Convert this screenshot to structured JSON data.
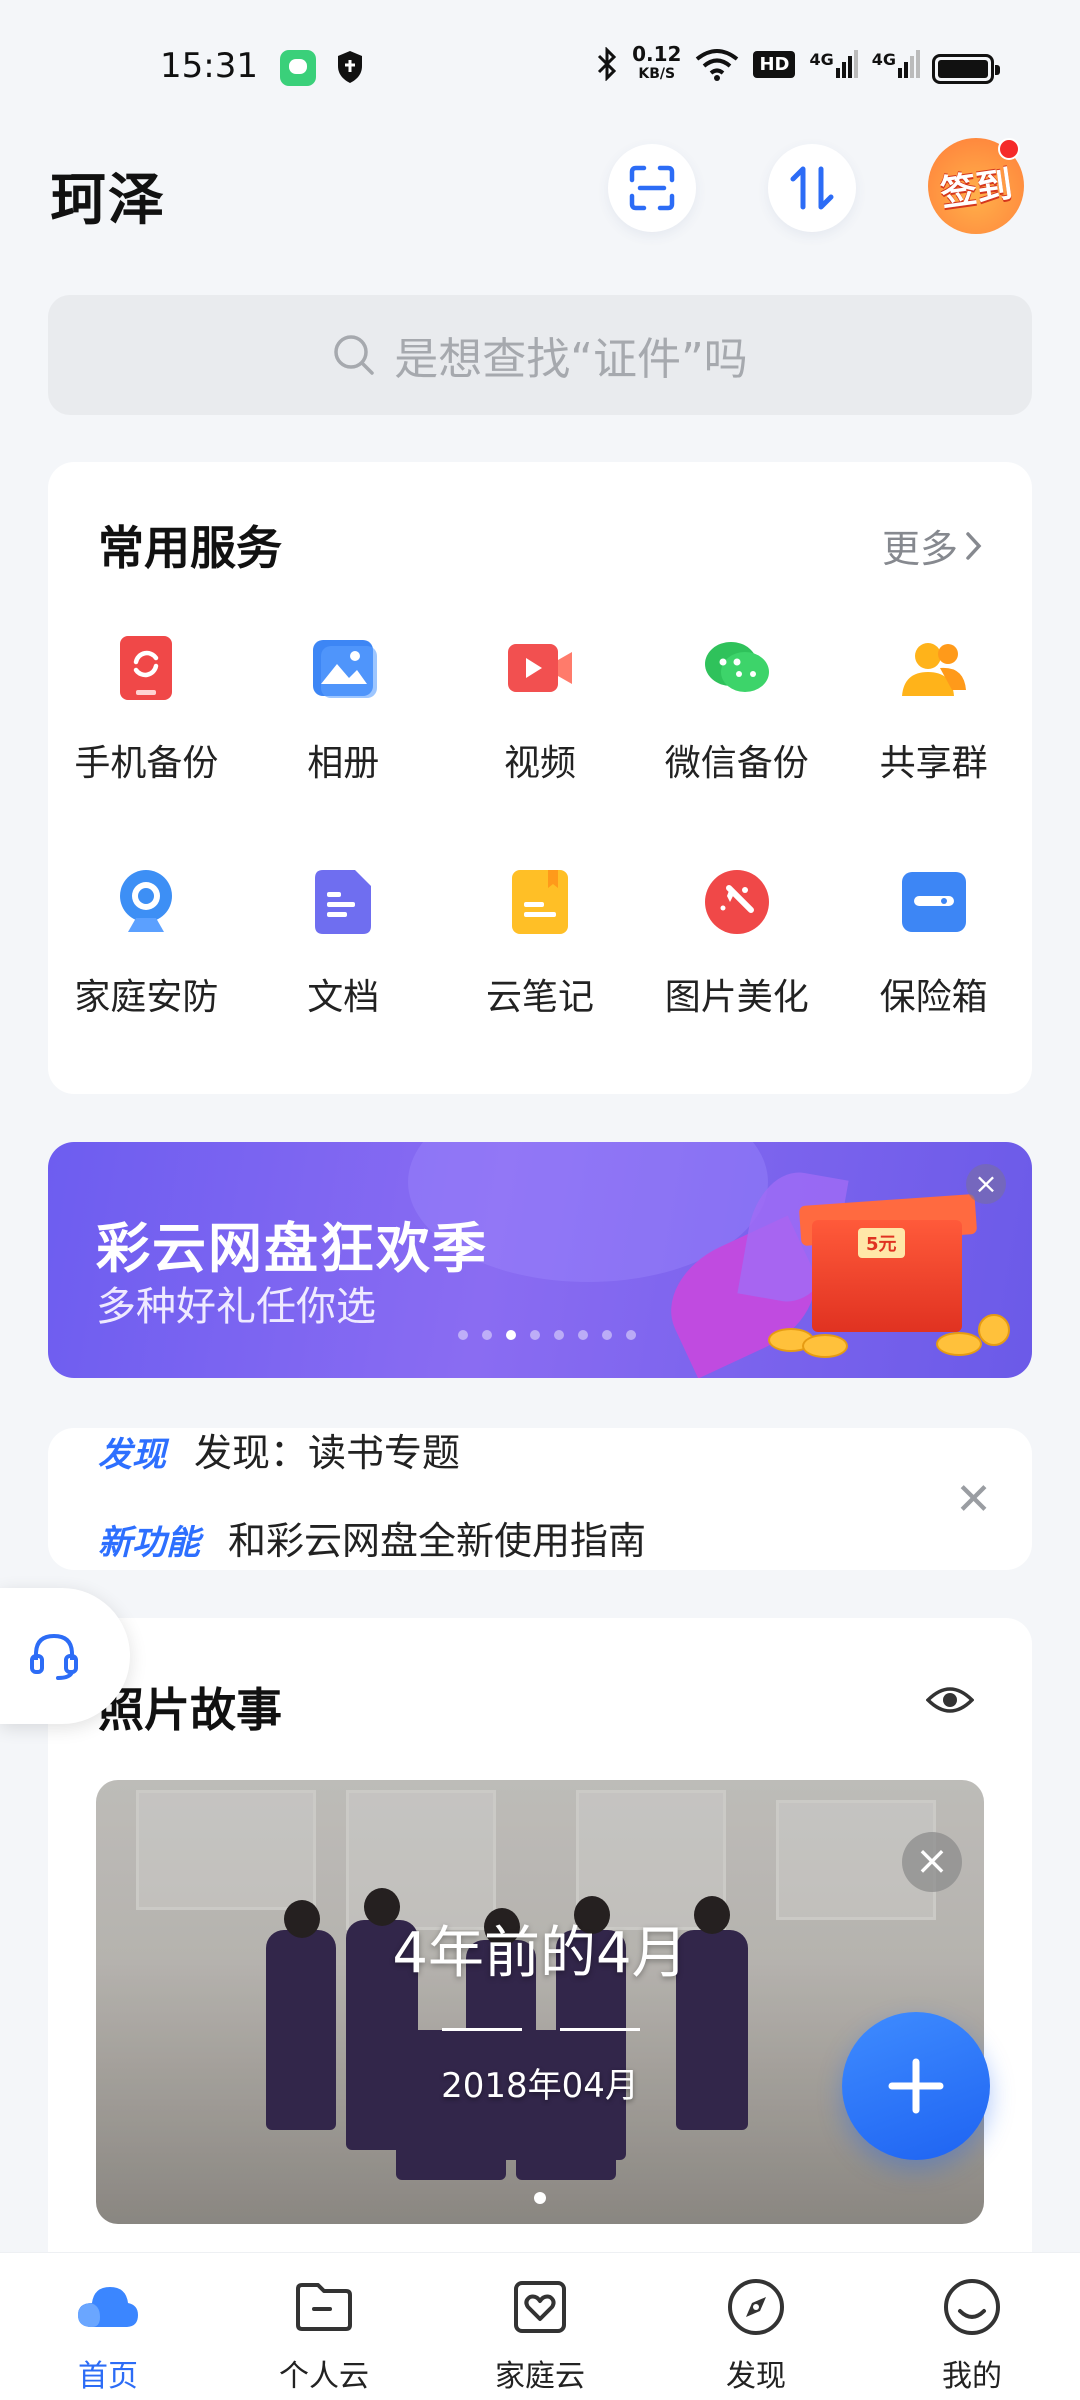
{
  "status_bar": {
    "time": "15:31",
    "speed_value": "0.12",
    "speed_unit": "KB/S",
    "hd_badge": "HD",
    "net1": "4G",
    "net2": "4G"
  },
  "header": {
    "title": "珂泽",
    "signin_label": "签到"
  },
  "search": {
    "placeholder": "是想查找“证件”吗"
  },
  "services": {
    "title": "常用服务",
    "more_label": "更多",
    "items": [
      {
        "label": "手机备份",
        "icon": "phone-backup-icon",
        "color": "#f04848"
      },
      {
        "label": "相册",
        "icon": "album-icon",
        "color": "#3d86f5"
      },
      {
        "label": "视频",
        "icon": "video-icon",
        "color": "#f25050"
      },
      {
        "label": "微信备份",
        "icon": "wechat-icon",
        "color": "#2fc25b"
      },
      {
        "label": "共享群",
        "icon": "share-group-icon",
        "color": "#ffb31a"
      },
      {
        "label": "家庭安防",
        "icon": "camera-icon",
        "color": "#3d8ff5"
      },
      {
        "label": "文档",
        "icon": "document-icon",
        "color": "#6f6ef0"
      },
      {
        "label": "云笔记",
        "icon": "note-icon",
        "color": "#ffbf26"
      },
      {
        "label": "图片美化",
        "icon": "beautify-icon",
        "color": "#f04848"
      },
      {
        "label": "保险箱",
        "icon": "safe-box-icon",
        "color": "#3d86f5"
      }
    ]
  },
  "banner": {
    "title": "彩云网盘狂欢季",
    "subtitle": "多种好礼任你选",
    "dot_count": 8,
    "active_dot": 2,
    "gift_text": "5元"
  },
  "ticker": {
    "row1_tag": "发现",
    "row1_text": "发现：读书专题",
    "row2_tag": "新功能",
    "row2_text": "和彩云网盘全新使用指南"
  },
  "story": {
    "title": "照片故事",
    "photo_title": "4年前的4月",
    "photo_date": "2018年04月"
  },
  "bottom_nav": {
    "items": [
      {
        "label": "首页",
        "icon": "cloud-icon",
        "active": true
      },
      {
        "label": "个人云",
        "icon": "folder-icon",
        "active": false
      },
      {
        "label": "家庭云",
        "icon": "family-heart-icon",
        "active": false
      },
      {
        "label": "发现",
        "icon": "compass-icon",
        "active": false
      },
      {
        "label": "我的",
        "icon": "smile-icon",
        "active": false
      }
    ]
  },
  "colors": {
    "accent": "#2c6cf6",
    "background": "#f4f6f9"
  }
}
